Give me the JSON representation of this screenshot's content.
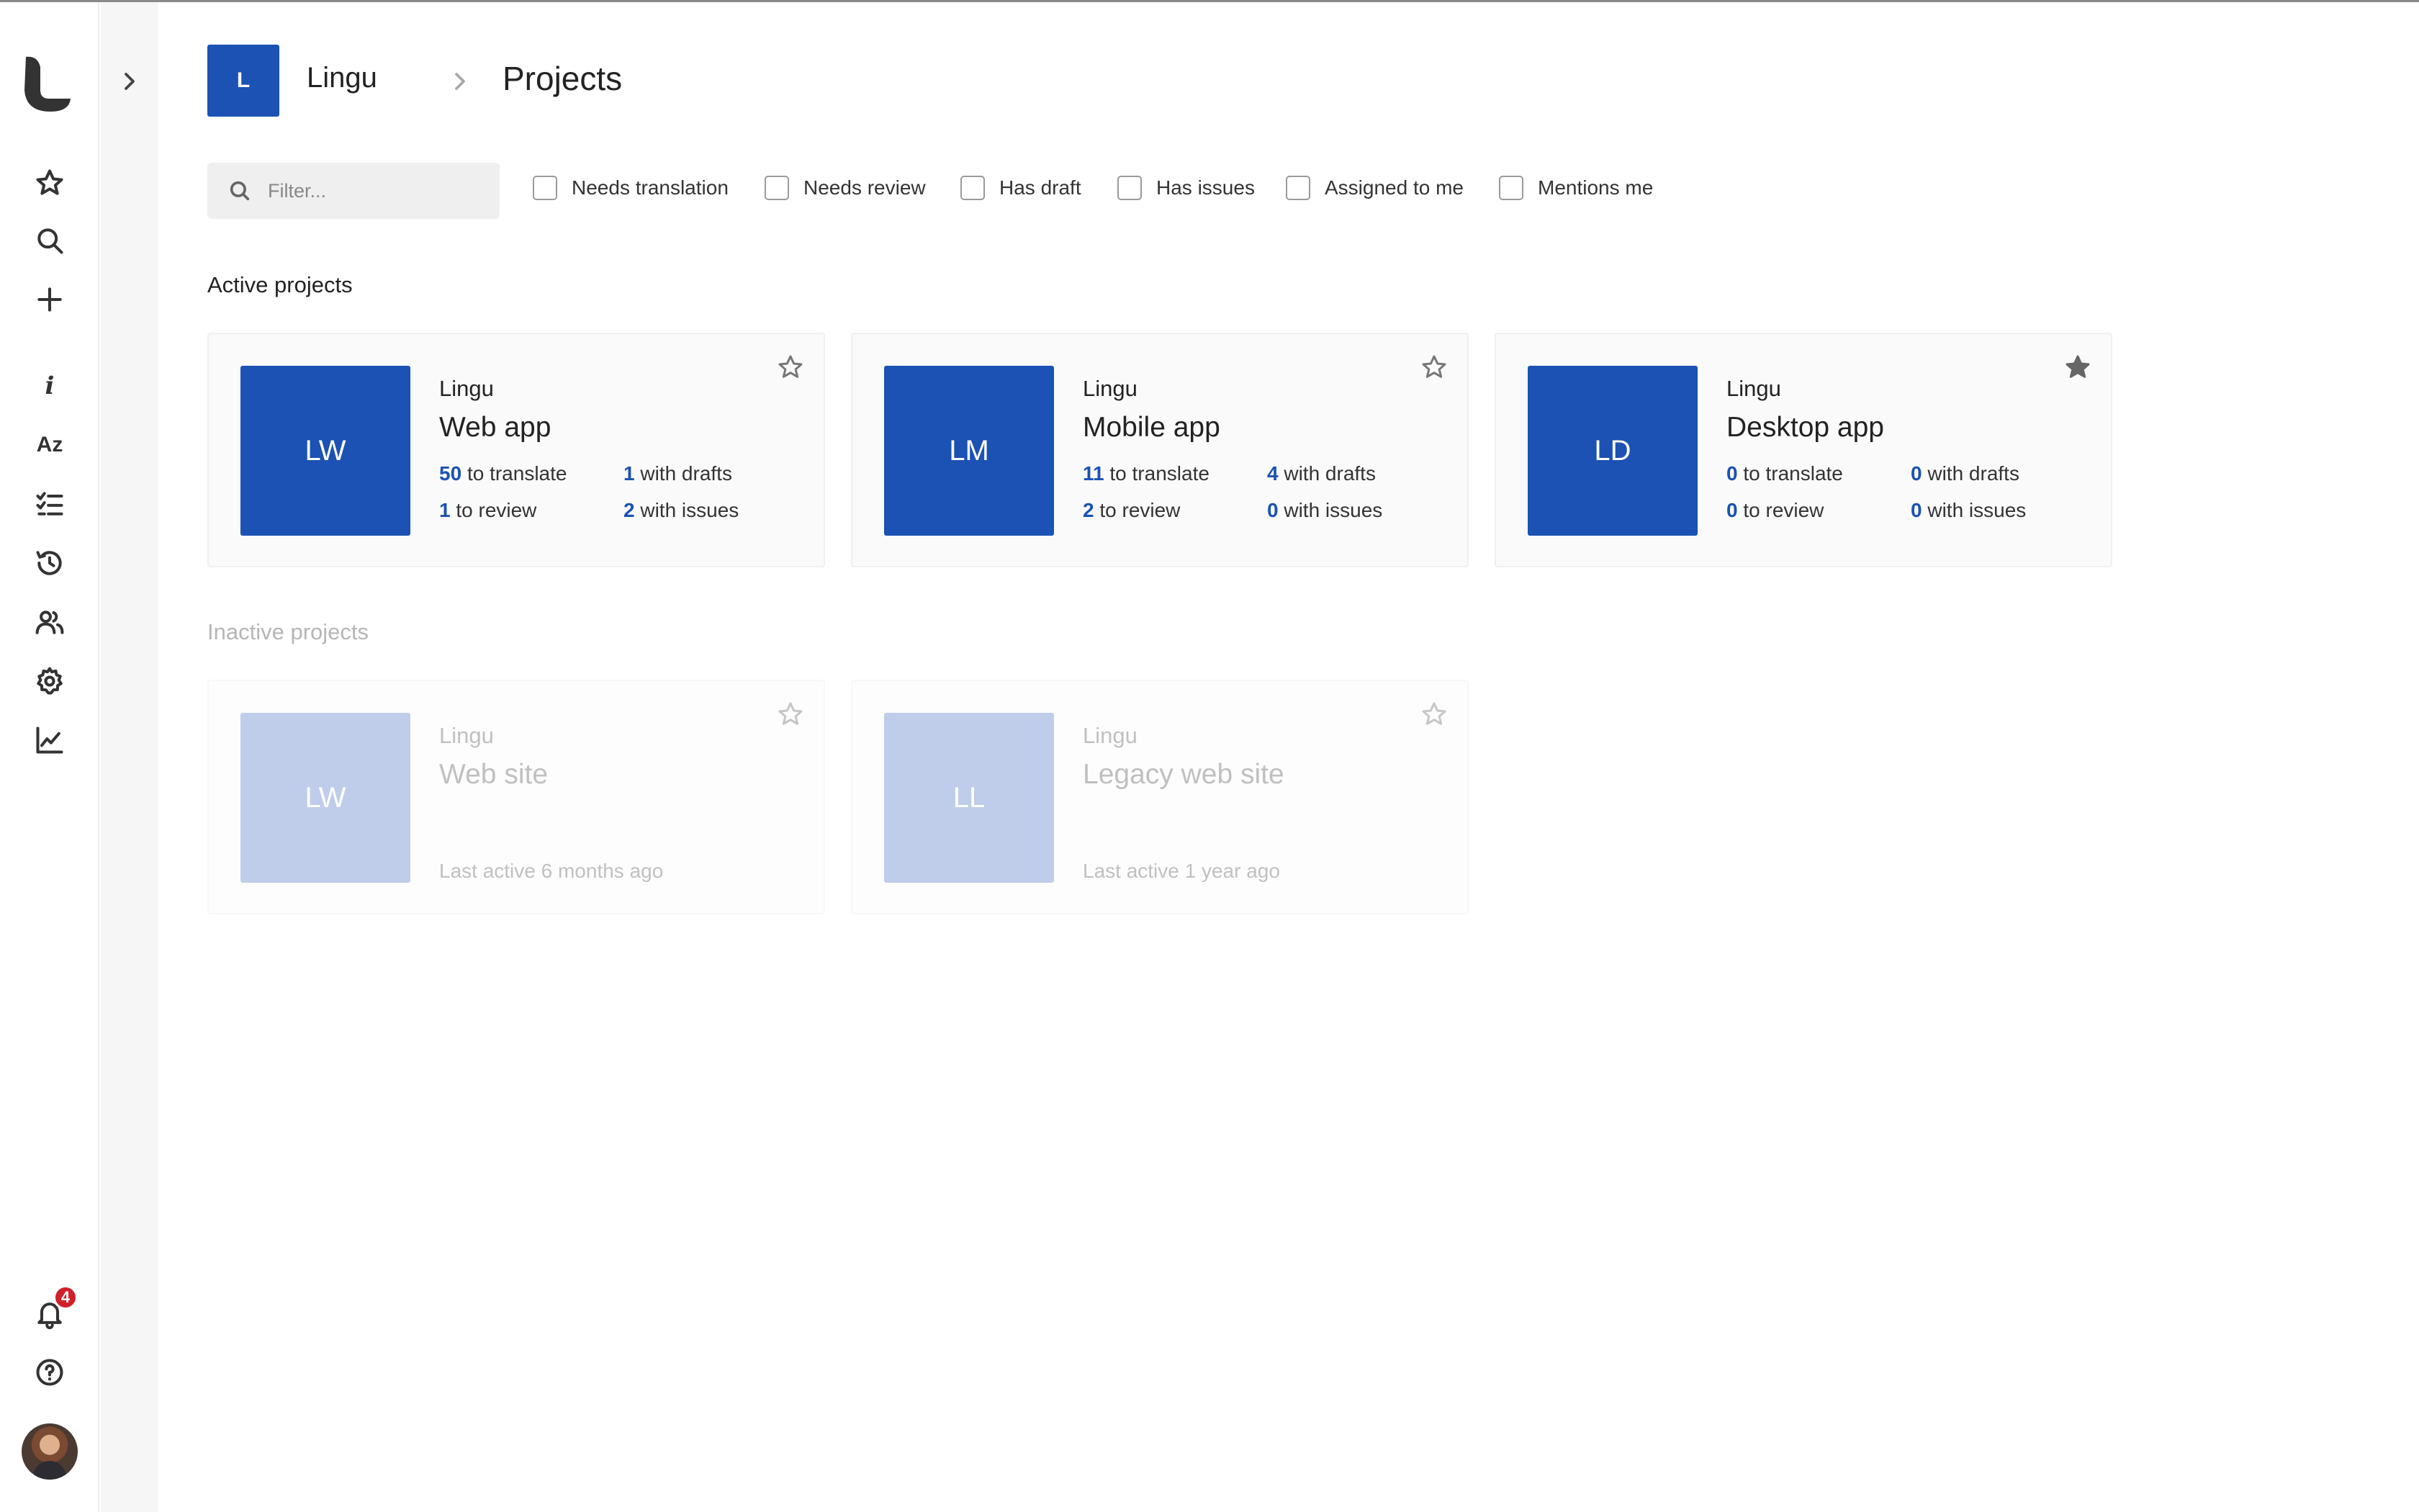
{
  "sidebar": {
    "logo_icon": "lingu-logo-icon",
    "items": [
      {
        "name": "favorites",
        "icon": "star-icon"
      },
      {
        "name": "search",
        "icon": "search-icon"
      },
      {
        "name": "add",
        "icon": "plus-icon"
      },
      {
        "name": "info",
        "icon": "info-icon"
      },
      {
        "name": "glossary",
        "icon": "az-icon"
      },
      {
        "name": "tasks",
        "icon": "checklist-icon"
      },
      {
        "name": "history",
        "icon": "history-icon"
      },
      {
        "name": "members",
        "icon": "users-icon"
      },
      {
        "name": "settings",
        "icon": "gear-icon"
      },
      {
        "name": "reports",
        "icon": "chart-icon"
      }
    ],
    "glossary_glyph": "Az",
    "info_glyph": "i",
    "notifications": {
      "icon": "bell-icon",
      "count": "4"
    },
    "help_icon": "help-icon",
    "avatar_icon": "user-avatar"
  },
  "header": {
    "org_initial": "L",
    "org_name": "Lingu",
    "title": "Projects"
  },
  "filters": {
    "search_placeholder": "Filter...",
    "checkboxes": [
      "Needs translation",
      "Needs review",
      "Has draft",
      "Has issues",
      "Assigned to me",
      "Mentions me"
    ]
  },
  "active_section": "Active projects",
  "active_projects": [
    {
      "initials": "LW",
      "org": "Lingu",
      "name": "Web app",
      "starred": false,
      "to_translate": "50",
      "to_translate_label": "to translate",
      "with_drafts": "1",
      "with_drafts_label": "with drafts",
      "to_review": "1",
      "to_review_label": "to review",
      "with_issues": "2",
      "with_issues_label": "with issues"
    },
    {
      "initials": "LM",
      "org": "Lingu",
      "name": "Mobile app",
      "starred": false,
      "to_translate": "11",
      "to_translate_label": "to translate",
      "with_drafts": "4",
      "with_drafts_label": "with drafts",
      "to_review": "2",
      "to_review_label": "to review",
      "with_issues": "0",
      "with_issues_label": "with issues"
    },
    {
      "initials": "LD",
      "org": "Lingu",
      "name": "Desktop app",
      "starred": true,
      "to_translate": "0",
      "to_translate_label": "to translate",
      "with_drafts": "0",
      "with_drafts_label": "with drafts",
      "to_review": "0",
      "to_review_label": "to review",
      "with_issues": "0",
      "with_issues_label": "with issues"
    }
  ],
  "inactive_section": "Inactive projects",
  "inactive_projects": [
    {
      "initials": "LW",
      "org": "Lingu",
      "name": "Web site",
      "last_active": "Last active 6 months ago",
      "starred": false
    },
    {
      "initials": "LL",
      "org": "Lingu",
      "name": "Legacy web site",
      "last_active": "Last active 1 year ago",
      "starred": false
    }
  ],
  "colors": {
    "accent": "#1b52b3",
    "inactive_tile": "#bfcdea",
    "badge": "#d0202a"
  }
}
